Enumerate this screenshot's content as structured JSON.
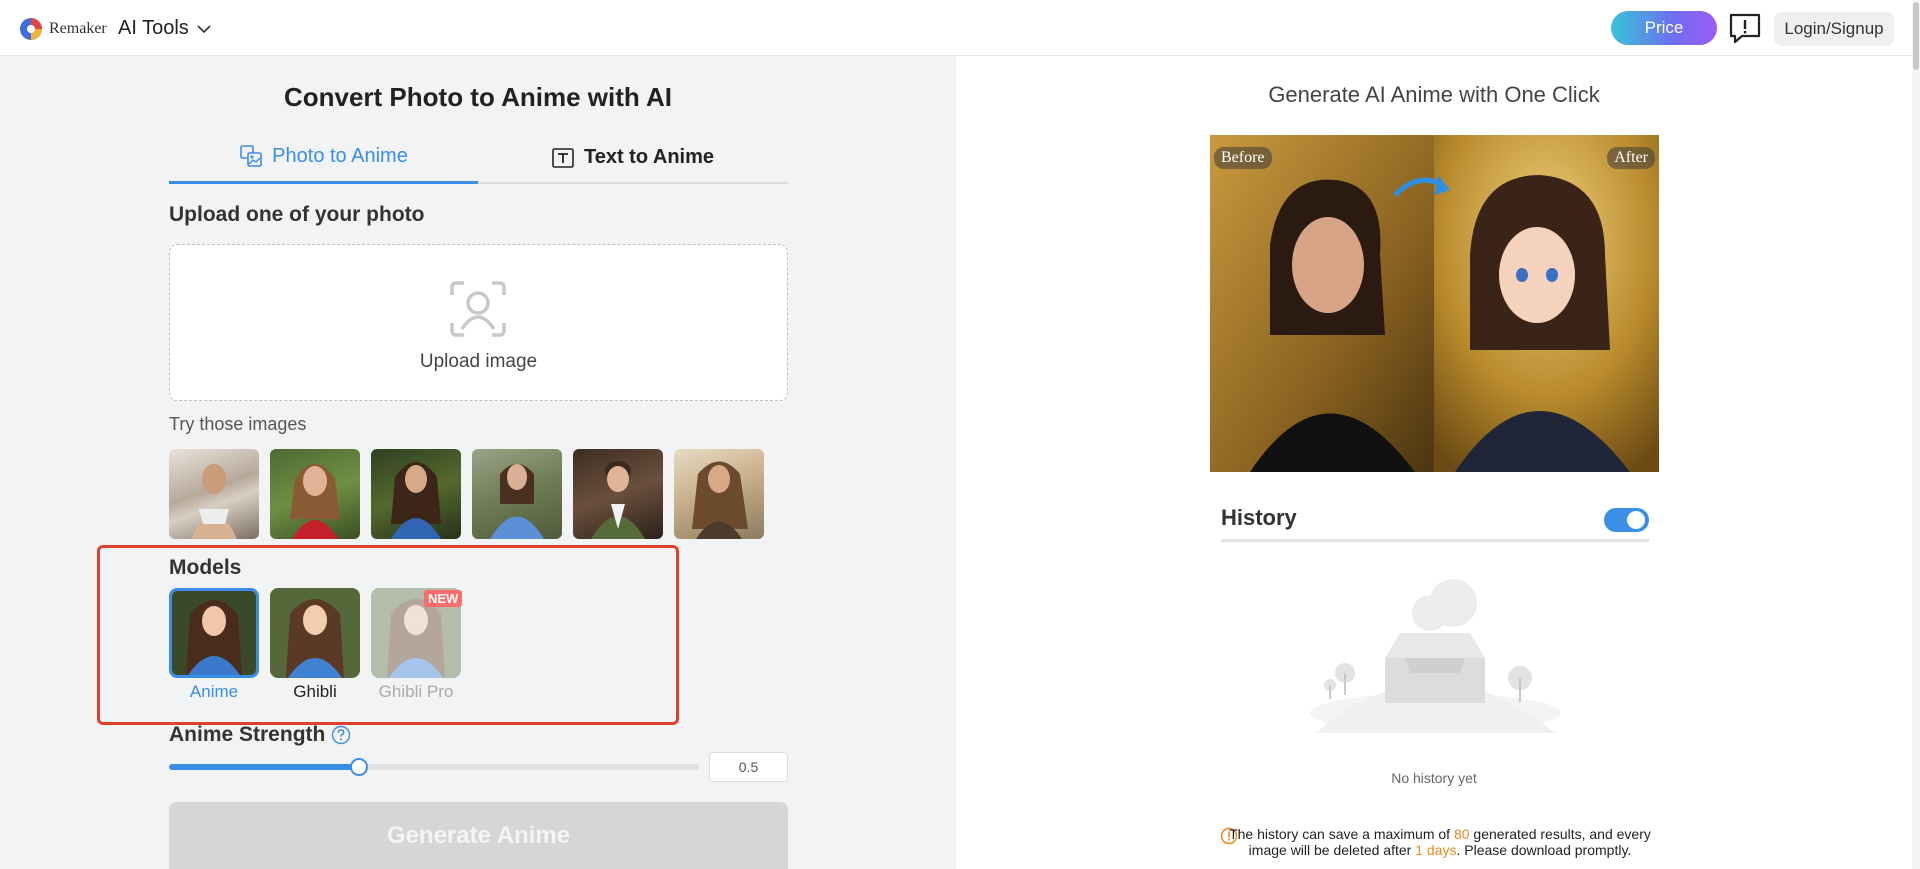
{
  "header": {
    "brand": "Remaker",
    "menu_label": "AI Tools",
    "price_label": "Price",
    "login_label": "Login/Signup"
  },
  "left": {
    "title": "Convert Photo to Anime with AI",
    "tabs": [
      {
        "label": "Photo to Anime",
        "active": true
      },
      {
        "label": "Text to Anime",
        "active": false
      }
    ],
    "upload_label": "Upload one of your photo",
    "upload_text": "Upload image",
    "try_label": "Try those images",
    "models_label": "Models",
    "models": [
      {
        "label": "Anime",
        "selected": true
      },
      {
        "label": "Ghibli",
        "selected": false
      },
      {
        "label": "Ghibli Pro",
        "selected": false,
        "badge": "NEW"
      }
    ],
    "strength_label": "Anime Strength",
    "strength_value": "0.5",
    "generate_label": "Generate Anime"
  },
  "right": {
    "title": "Generate AI Anime with One Click",
    "before_label": "Before",
    "after_label": "After",
    "history_label": "History",
    "history_enabled": true,
    "empty_text": "No history yet",
    "note_part1": "The history can save a maximum of ",
    "note_max": "80",
    "note_part2": " generated results, and every image will be deleted after ",
    "note_days": "1 days",
    "note_part3": ". Please download promptly."
  },
  "colors": {
    "accent": "#3a8ee6",
    "highlight_box": "#e0412c",
    "note_highlight": "#e88b1a"
  }
}
